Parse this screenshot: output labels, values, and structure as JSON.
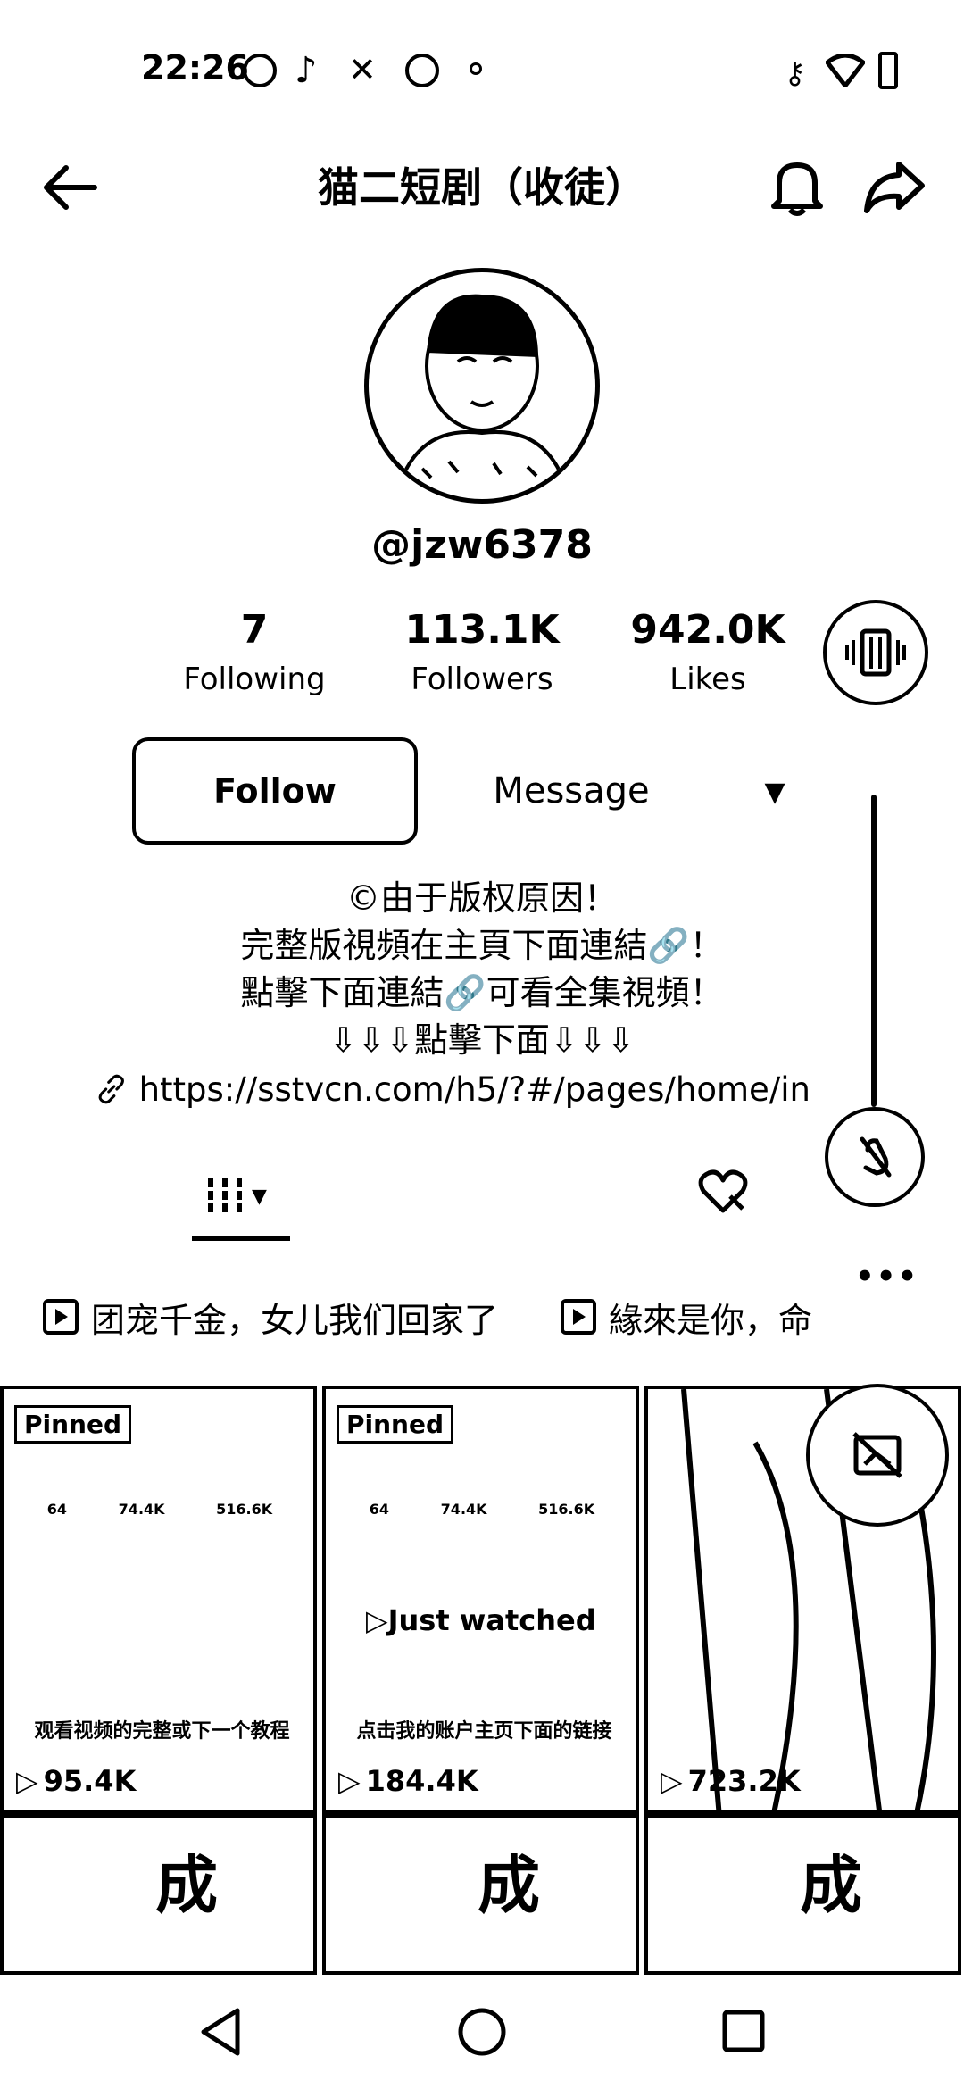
{
  "status_bar": {
    "time": "22:26"
  },
  "header": {
    "title": "猫二短剧（收徒）"
  },
  "profile": {
    "username": "@jzw6378",
    "stats": [
      {
        "value": "7",
        "label": "Following"
      },
      {
        "value": "113.1K",
        "label": "Followers"
      },
      {
        "value": "942.0K",
        "label": "Likes"
      }
    ],
    "follow_label": "Follow",
    "message_label": "Message",
    "bio_lines": [
      "©由于版权原因！",
      "完整版視頻在主頁下面連結🔗！",
      "點擊下面連結🔗可看全集視頻！",
      "⇩⇩⇩點擊下面⇩⇩⇩"
    ],
    "link": "https://sstvcn.com/h5/?#/pages/home/in"
  },
  "playlists": [
    {
      "name": "团宠千金，女儿我们回家了"
    },
    {
      "name": "緣來是你，命"
    }
  ],
  "videos": [
    {
      "badge": "Pinned",
      "views": "95.4K",
      "mini_stats": [
        "64",
        "74.4K",
        "516.6K"
      ],
      "caption": "观看视频的完整或下一个教程"
    },
    {
      "badge": "Pinned",
      "views": "184.4K",
      "overlay": "Just watched",
      "mini_stats": [
        "64",
        "74.4K",
        "516.6K"
      ],
      "caption": "点击我的账户主页下面的链接"
    },
    {
      "views": "723.2K"
    },
    {
      "char": "成"
    },
    {
      "char": "成"
    },
    {
      "char": "成"
    }
  ]
}
